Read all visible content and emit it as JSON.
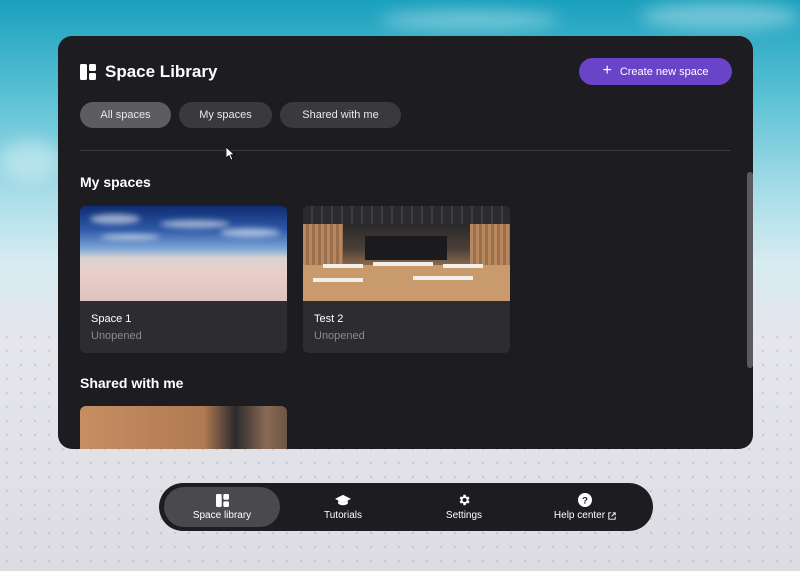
{
  "header": {
    "title": "Space Library",
    "create_button_label": "Create new space"
  },
  "tabs": [
    {
      "label": "All spaces",
      "active": true
    },
    {
      "label": "My spaces",
      "active": false
    },
    {
      "label": "Shared with me",
      "active": false
    }
  ],
  "sections": {
    "my_spaces": {
      "title": "My spaces",
      "cards": [
        {
          "name": "Space 1",
          "status": "Unopened",
          "thumbnail": "sky-horizon"
        },
        {
          "name": "Test 2",
          "status": "Unopened",
          "thumbnail": "wooden-hall"
        }
      ]
    },
    "shared_with_me": {
      "title": "Shared with me"
    }
  },
  "dock": {
    "items": [
      {
        "label": "Space library",
        "icon": "library-icon",
        "active": true
      },
      {
        "label": "Tutorials",
        "icon": "graduation-cap-icon",
        "active": false
      },
      {
        "label": "Settings",
        "icon": "gear-icon",
        "active": false
      },
      {
        "label": "Help center",
        "icon": "question-icon",
        "active": false,
        "external": true
      }
    ]
  },
  "colors": {
    "panel": "#1d1c21",
    "accent": "#6a44c8",
    "tab": "#3a393e",
    "tab_active": "#5d5c61",
    "card": "#2d2c31"
  }
}
